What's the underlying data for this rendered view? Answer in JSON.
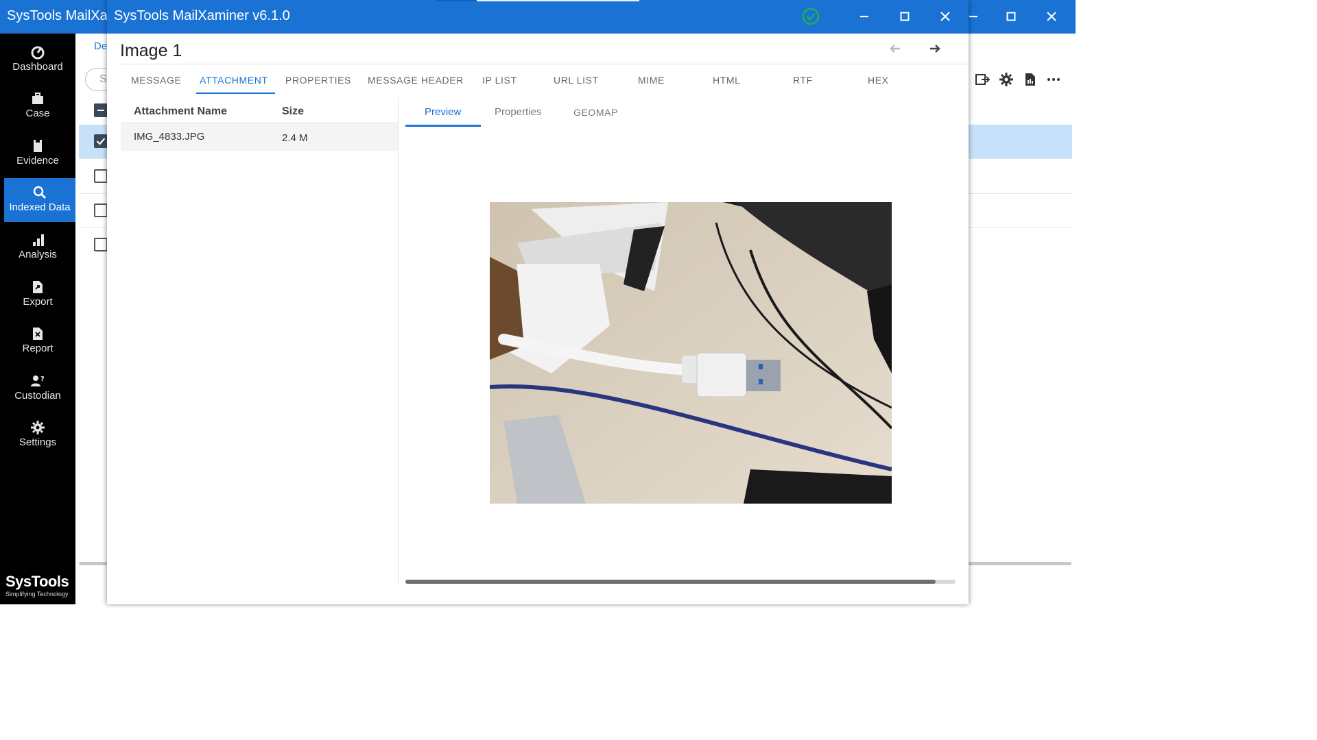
{
  "main_window": {
    "title": "SysTools MailXa",
    "breadcrumb": "De",
    "search_placeholder": "S",
    "sidebar": [
      {
        "label": "Dashboard",
        "icon": "dashboard-icon"
      },
      {
        "label": "Case",
        "icon": "briefcase-icon"
      },
      {
        "label": "Evidence",
        "icon": "evidence-icon"
      },
      {
        "label": "Indexed Data",
        "icon": "search-icon"
      },
      {
        "label": "Analysis",
        "icon": "bar-chart-icon"
      },
      {
        "label": "Export",
        "icon": "export-file-icon"
      },
      {
        "label": "Report",
        "icon": "report-file-icon"
      },
      {
        "label": "Custodian",
        "icon": "custodian-icon"
      },
      {
        "label": "Settings",
        "icon": "gear-icon"
      }
    ],
    "active_nav": "Indexed Data",
    "brand": {
      "name": "SysTools",
      "tagline": "Simplifying Technology"
    }
  },
  "dialog": {
    "title": "SysTools MailXaminer v6.1.0",
    "heading": "Image 1",
    "tabs": [
      "MESSAGE",
      "ATTACHMENT",
      "PROPERTIES",
      "MESSAGE HEADER",
      "IP LIST",
      "URL LIST",
      "MIME",
      "HTML",
      "RTF",
      "HEX"
    ],
    "active_tab": "ATTACHMENT",
    "attachments": {
      "columns": [
        "Attachment Name",
        "Size"
      ],
      "rows": [
        {
          "name": "IMG_4833.JPG",
          "size": "2.4 M"
        }
      ]
    },
    "preview_tabs": [
      "Preview",
      "Properties",
      "GEOMAP"
    ],
    "active_preview_tab": "Preview"
  },
  "colors": {
    "accent": "#1a73d4",
    "sidebar_bg": "#000000",
    "selected_row": "#c8e1fb",
    "status_ok": "#22b14c"
  }
}
